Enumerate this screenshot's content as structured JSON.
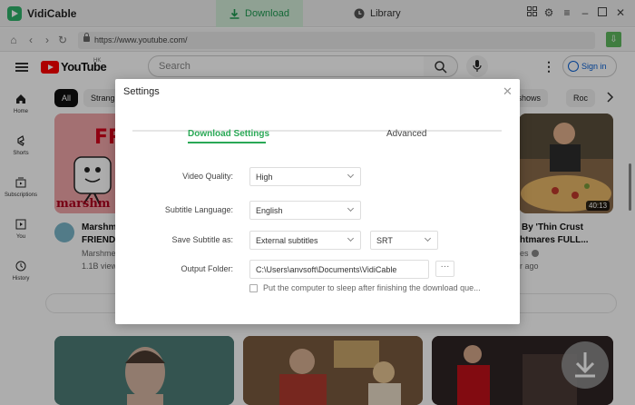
{
  "app": {
    "name": "VidiCable",
    "tab_download": "Download",
    "tab_library": "Library"
  },
  "browser": {
    "url": "https://www.youtube.com/"
  },
  "youtube": {
    "logo_text": "YouTube",
    "region": "HK",
    "search_placeholder": "Search",
    "sign_in": "Sign in",
    "sidebar": [
      {
        "label": "Home",
        "icon": "home-icon"
      },
      {
        "label": "Shorts",
        "icon": "shorts-icon"
      },
      {
        "label": "Subscriptions",
        "icon": "subscriptions-icon"
      },
      {
        "label": "You",
        "icon": "you-icon"
      },
      {
        "label": "History",
        "icon": "history-icon"
      }
    ],
    "chips": [
      "All",
      "Strang",
      "ne shows",
      "Roc"
    ],
    "videos": [
      {
        "title": "Marshm",
        "title2": "FRIENDS",
        "channel": "Marshme",
        "meta": "1.1B view"
      },
      {
        "title": "By 'Thin Crust",
        "title2": "htmares FULL...",
        "channel": "es",
        "meta": "r ago",
        "duration": "40:13"
      }
    ],
    "thumb_text": "FR",
    "thumb_text2": "marshm"
  },
  "dialog": {
    "title": "Settings",
    "tab_download_settings": "Download Settings",
    "tab_advanced": "Advanced",
    "video_quality_label": "Video Quality:",
    "video_quality": "High",
    "subtitle_language_label": "Subtitle Language:",
    "subtitle_language": "English",
    "save_subtitle_label": "Save Subtitle as:",
    "save_subtitle": "External subtitles",
    "subtitle_format": "SRT",
    "output_folder_label": "Output Folder:",
    "output_folder": "C:\\Users\\anvsoft\\Documents\\VidiCable",
    "more_button": "···",
    "sleep_option": "Put the computer to sleep after finishing the download que..."
  },
  "colors": {
    "accent": "#2aa856",
    "youtube_red": "#ff0000"
  }
}
